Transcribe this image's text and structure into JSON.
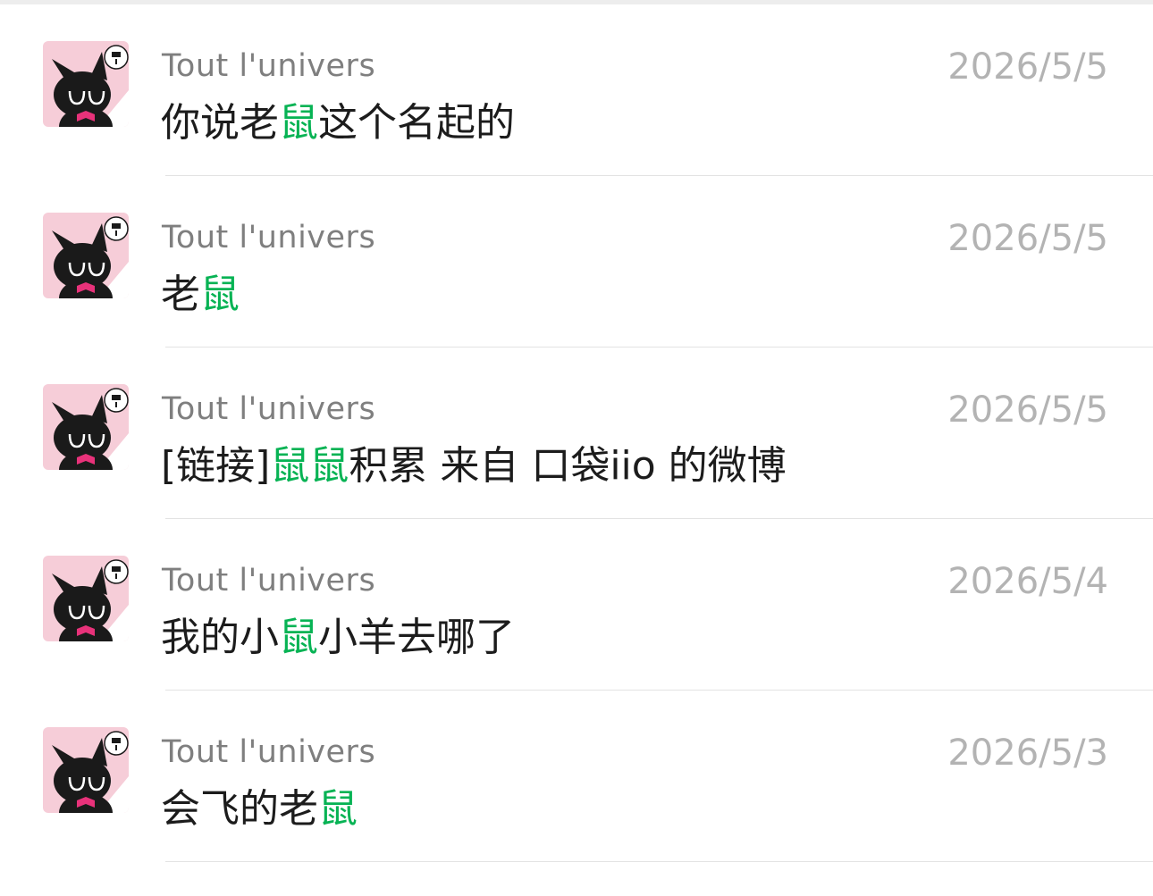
{
  "results": [
    {
      "contact": "Tout l'univers",
      "date": "2026/5/5",
      "snippet": [
        {
          "text": "你说老",
          "hl": false
        },
        {
          "text": "鼠",
          "hl": true
        },
        {
          "text": "这个名起的",
          "hl": false
        }
      ]
    },
    {
      "contact": "Tout l'univers",
      "date": "2026/5/5",
      "snippet": [
        {
          "text": "老",
          "hl": false
        },
        {
          "text": "鼠",
          "hl": true
        }
      ]
    },
    {
      "contact": "Tout l'univers",
      "date": "2026/5/5",
      "snippet": [
        {
          "text": "[链接]",
          "hl": false
        },
        {
          "text": "鼠鼠",
          "hl": true
        },
        {
          "text": "积累 来自 口袋iio 的微博",
          "hl": false
        }
      ]
    },
    {
      "contact": "Tout l'univers",
      "date": "2026/5/4",
      "snippet": [
        {
          "text": "我的小",
          "hl": false
        },
        {
          "text": "鼠",
          "hl": true
        },
        {
          "text": "小羊去哪了",
          "hl": false
        }
      ]
    },
    {
      "contact": "Tout l'univers",
      "date": "2026/5/3",
      "snippet": [
        {
          "text": "会飞的老",
          "hl": false
        },
        {
          "text": "鼠",
          "hl": true
        }
      ]
    }
  ],
  "colors": {
    "highlight": "#07b354",
    "name": "#7f7f7f",
    "date": "#b3b3b3",
    "text": "#1c1c1c",
    "avatar_bg": "#f6cdd8"
  },
  "icons": {
    "avatar": "black-cat-avatar-icon"
  }
}
